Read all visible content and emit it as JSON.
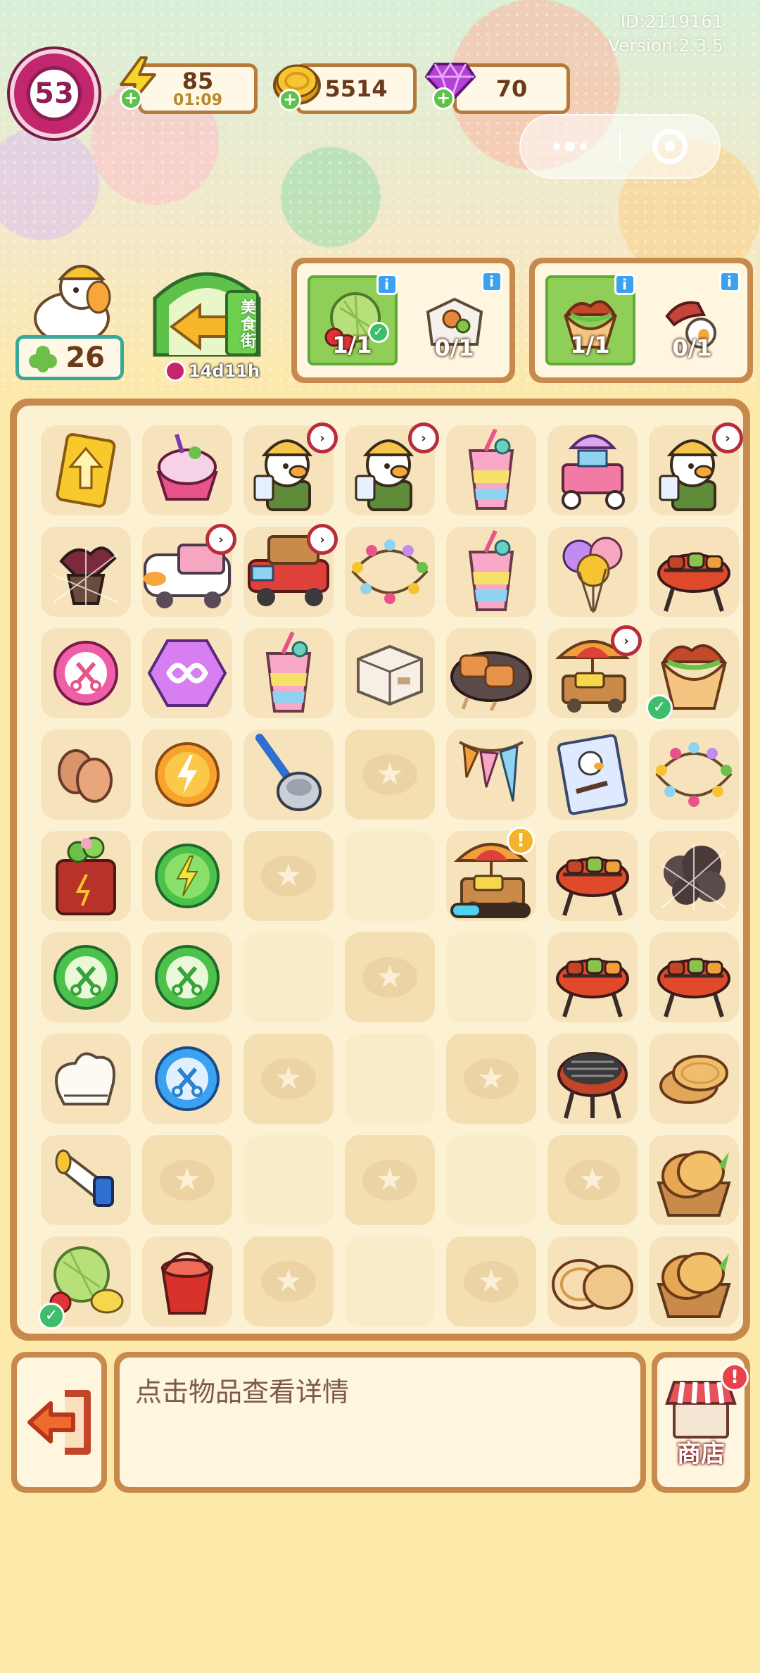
{
  "header": {
    "id_text": "ID:2119161",
    "version_text": "Version:2.3.5",
    "level": "53",
    "energy": {
      "value": "85",
      "timer": "01:09"
    },
    "coins": {
      "value": "5514"
    },
    "gems": {
      "value": "70"
    },
    "clover": {
      "value": "26"
    },
    "event": {
      "sign": "美食街",
      "timer": "14d11h"
    }
  },
  "orders": [
    {
      "slots": [
        {
          "icon": "melon-cherry-icon",
          "count": "1/1",
          "done": true
        },
        {
          "icon": "takeout-box-icon",
          "count": "0/1",
          "done": false
        }
      ]
    },
    {
      "slots": [
        {
          "icon": "chicken-wrap-icon",
          "count": "1/1",
          "done": true
        },
        {
          "icon": "pepper-keychain-icon",
          "count": "0/1",
          "done": false
        }
      ]
    }
  ],
  "board": {
    "rows": [
      [
        "up-arrow-card-icon",
        "ice-cream-cup-icon",
        "duck-chef-icon",
        "duck-chef-icon",
        "rainbow-drink-icon",
        "food-cart-icon",
        "duck-chef-icon"
      ],
      [
        "cobweb-plant-icon",
        "ice-cream-van-icon",
        "delivery-truck-icon",
        "string-lights-icon",
        "rainbow-drink-icon",
        "balloons-icon",
        "bbq-grill-icon"
      ],
      [
        "pink-scissors-orb-icon",
        "infinity-gem-icon",
        "rainbow-drink-icon",
        "cardboard-box-icon",
        "skewers-plate-icon",
        "umbrella-cart-icon",
        "chicken-wrap-icon"
      ],
      [
        "eggs-icon",
        "orange-energy-orb-icon",
        "ice-cream-scoop-icon",
        "empty",
        "bunting-flags-icon",
        "duck-poster-icon",
        "string-lights-icon"
      ],
      [
        "plant-box-icon",
        "green-energy-orb-icon",
        "empty",
        "blank",
        "umbrella-cart-icon",
        "bbq-grill-icon",
        "cobweb-cloud-icon"
      ],
      [
        "green-scissors-orb-icon",
        "green-scissors-orb-icon",
        "blank",
        "empty",
        "blank",
        "bbq-grill-icon",
        "bbq-grill-icon"
      ],
      [
        "chef-hat-icon",
        "blue-scissors-orb-icon",
        "empty",
        "blank",
        "empty",
        "charcoal-grill-icon",
        "pancakes-icon"
      ],
      [
        "megaphone-icon",
        "empty",
        "blank",
        "empty",
        "blank",
        "empty",
        "pancake-basket-icon"
      ],
      [
        "melon-fruits-icon",
        "red-bucket-icon",
        "empty",
        "blank",
        "empty",
        "sliced-bread-icon",
        "pancake-basket-icon"
      ]
    ],
    "badges": {
      "timer_cells": [
        "0-2",
        "0-3",
        "0-6",
        "1-1",
        "1-2",
        "2-5"
      ],
      "check_cells": [
        "2-6",
        "8-0"
      ],
      "alert_cells": [
        "4-4"
      ],
      "progress_cells": [
        {
          "cell": "4-4",
          "progress": 0.35
        }
      ]
    }
  },
  "bottom": {
    "hint": "点击物品查看详情",
    "exit_icon": "exit-door-icon",
    "shop_label": "商店",
    "shop_alert": "!"
  },
  "colors": {
    "frame": "#c8894c",
    "panel": "#fff6df",
    "level_ring": "#c2266c",
    "clover_border": "#38a89a",
    "check": "#3ebe6a",
    "timer_ring": "#b72d3b"
  }
}
